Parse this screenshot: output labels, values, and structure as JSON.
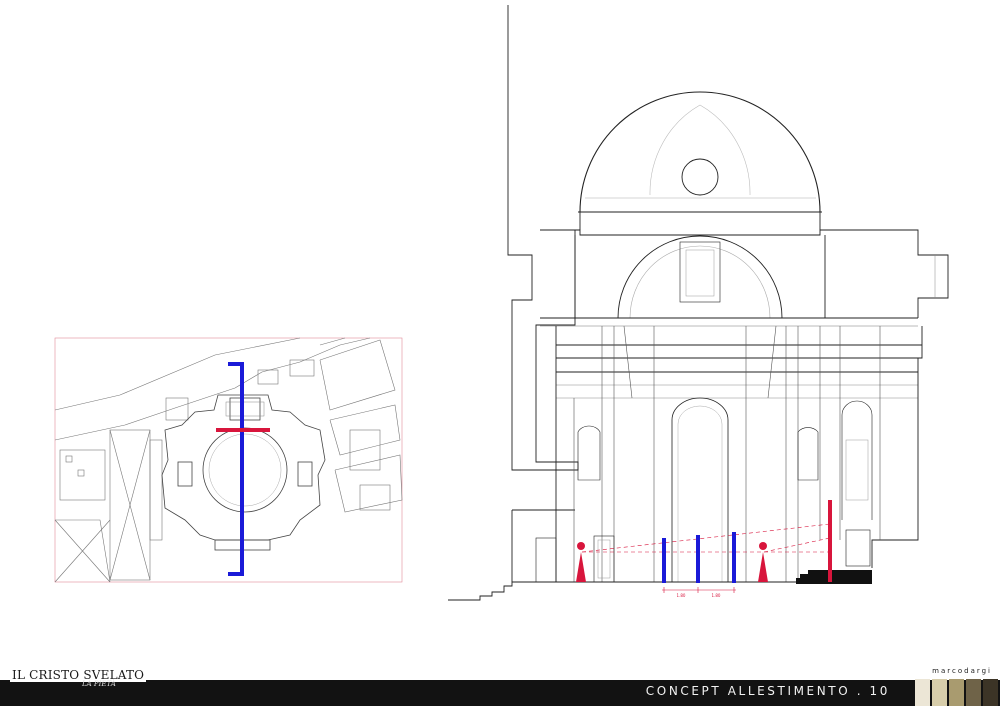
{
  "project": {
    "title": "IL CRISTO SVELATO",
    "subtitle": "LA PIETÀ"
  },
  "sheet": {
    "title": "CONCEPT ALLESTIMENTO . 10",
    "author": "marcodargi"
  },
  "dimensions": {
    "spacing_a": "1.80",
    "spacing_b": "1.80"
  },
  "colors": {
    "section_line": "#1a1ad8",
    "exhibit_red": "#d8153c",
    "footer": "#121212",
    "swatches": [
      "#ece6d6",
      "#d7cdaa",
      "#a99b6f",
      "#6f6348",
      "#3c3426"
    ]
  }
}
